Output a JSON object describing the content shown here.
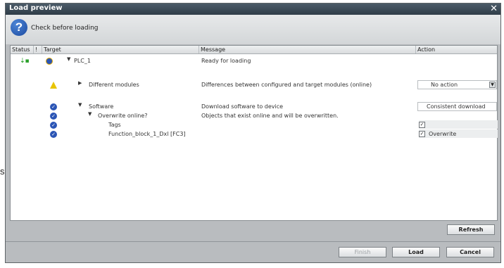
{
  "stray_text": "s",
  "window": {
    "title": "Load preview",
    "close_glyph": "✕"
  },
  "header": {
    "text": "Check before loading"
  },
  "columns": {
    "status": "Status",
    "bang": "!",
    "target": "Target",
    "message": "Message",
    "action": "Action"
  },
  "rows": {
    "plc": {
      "target": "PLC_1",
      "message": "Ready for loading"
    },
    "modules": {
      "target": "Different modules",
      "message": "Differences between configured and target modules (online)",
      "action": "No action"
    },
    "software": {
      "target": "Software",
      "message": "Download software to device",
      "action": "Consistent download"
    },
    "overwrite": {
      "target": "Overwrite online?",
      "message": "Objects that exist online and will be overwritten."
    },
    "tags": {
      "target": "Tags"
    },
    "fb": {
      "target": "Function_block_1_Dxl [FC3]",
      "action": "Overwrite"
    }
  },
  "buttons": {
    "refresh": "Refresh",
    "finish": "Finish",
    "load": "Load",
    "cancel": "Cancel"
  },
  "colors": {
    "titlebar": "#3c4b57",
    "accent_blue": "#2b55b5",
    "warning": "#e8c400"
  }
}
